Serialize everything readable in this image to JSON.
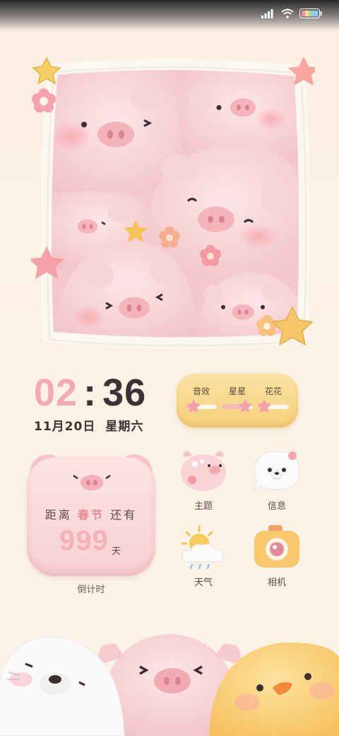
{
  "status_bar": {
    "icons": [
      "signal-icon",
      "wifi-icon",
      "battery-icon"
    ]
  },
  "clock": {
    "hour": "02",
    "colon": ":",
    "minute": "36",
    "date": "11月20日",
    "weekday": "星期六"
  },
  "sliders": [
    {
      "label": "音效",
      "level": 0.25
    },
    {
      "label": "星星",
      "level": 0.75
    },
    {
      "label": "花花",
      "level": 0.2
    }
  ],
  "countdown": {
    "prefix": "距离",
    "event": "春节",
    "suffix": "还有",
    "days": "999",
    "unit": "天",
    "caption": "倒计时"
  },
  "apps": [
    {
      "label": "主题",
      "icon": "palette-pig-icon"
    },
    {
      "label": "信息",
      "icon": "seal-chat-icon"
    },
    {
      "label": "天气",
      "icon": "sun-cloud-icon"
    },
    {
      "label": "相机",
      "icon": "camera-icon"
    }
  ],
  "colors": {
    "background": "#fbf1e4",
    "pig_pink": "#f7cfd3",
    "accent_pink": "#e98a95",
    "yellow": "#f6cf79",
    "text_dark": "#3a3332"
  }
}
